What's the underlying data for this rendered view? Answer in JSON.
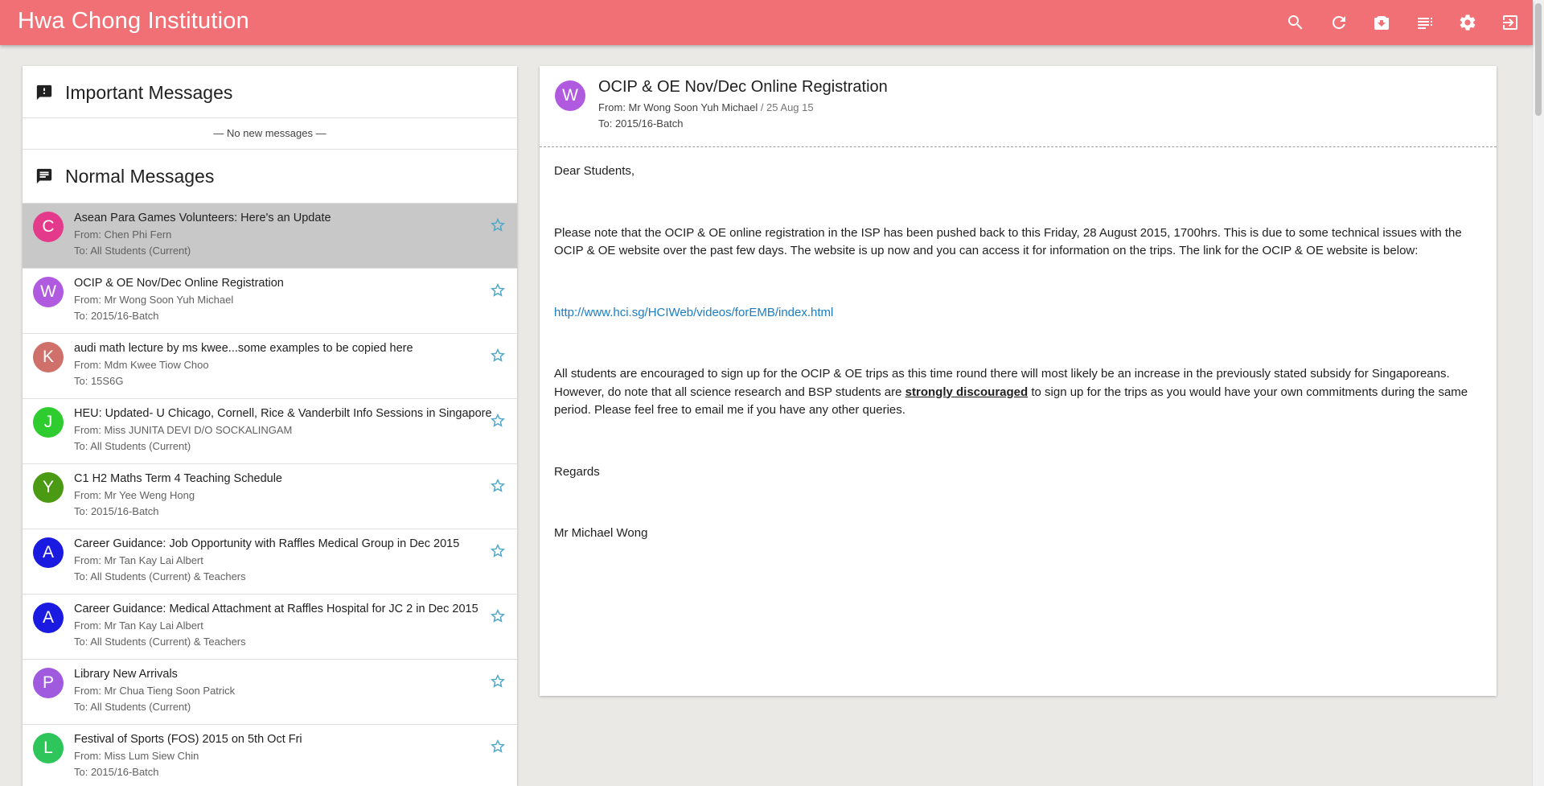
{
  "app": {
    "title": "Hwa Chong Institution"
  },
  "toolbar": {
    "icons": [
      "search-icon",
      "refresh-icon",
      "archive-icon",
      "list-icon",
      "settings-icon",
      "logout-icon"
    ],
    "brand_color": "#f07075"
  },
  "important": {
    "title": "Important Messages",
    "empty_text": "— No new messages —"
  },
  "normal": {
    "title": "Normal Messages",
    "messages": [
      {
        "initial": "C",
        "color": "#e33a8c",
        "subject": "Asean Para Games Volunteers: Here's an Update",
        "from": "From: Chen Phi Fern",
        "to": "To: All Students (Current)",
        "selected": true
      },
      {
        "initial": "W",
        "color": "#b05ae0",
        "subject": "OCIP & OE Nov/Dec Online Registration",
        "from": "From: Mr Wong Soon Yuh Michael",
        "to": "To: 2015/16-Batch"
      },
      {
        "initial": "K",
        "color": "#d0706a",
        "subject": "audi math lecture by ms kwee...some examples to be copied here",
        "from": "From: Mdm Kwee Tiow Choo",
        "to": "To: 15S6G"
      },
      {
        "initial": "J",
        "color": "#2ecc2e",
        "subject": "HEU: Updated- U Chicago, Cornell, Rice & Vanderbilt Info Sessions in Singapore",
        "from": "From: Miss JUNITA DEVI D/O SOCKALINGAM",
        "to": "To: All Students (Current)"
      },
      {
        "initial": "Y",
        "color": "#4a9a14",
        "subject": "C1 H2 Maths Term 4 Teaching Schedule",
        "from": "From: Mr Yee Weng Hong",
        "to": "To: 2015/16-Batch"
      },
      {
        "initial": "A",
        "color": "#1a1ae0",
        "subject": "Career Guidance: Job Opportunity with Raffles Medical Group in Dec 2015",
        "from": "From: Mr Tan Kay Lai Albert",
        "to": "To: All Students (Current) & Teachers"
      },
      {
        "initial": "A",
        "color": "#1a1ae0",
        "subject": "Career Guidance: Medical Attachment at Raffles Hospital for JC 2 in Dec 2015",
        "from": "From: Mr Tan Kay Lai Albert",
        "to": "To: All Students (Current) & Teachers"
      },
      {
        "initial": "P",
        "color": "#a05ae0",
        "subject": "Library New Arrivals",
        "from": "From: Mr Chua Tieng Soon Patrick",
        "to": "To: All Students (Current)"
      },
      {
        "initial": "L",
        "color": "#2ec65a",
        "subject": "Festival of Sports (FOS) 2015 on 5th Oct Fri",
        "from": "From: Miss Lum Siew Chin",
        "to": "To: 2015/16-Batch"
      }
    ]
  },
  "detail": {
    "initial": "W",
    "color": "#b05ae0",
    "subject": "OCIP & OE Nov/Dec Online Registration",
    "from": "From: Mr Wong Soon Yuh Michael",
    "date": " / 25 Aug 15",
    "to": "To: 2015/16-Batch",
    "greeting": "Dear Students,",
    "para1": "Please note that the OCIP & OE online registration in the ISP has been pushed back to this Friday, 28 August 2015, 1700hrs. This is due to some technical issues with the OCIP & OE website over the past few days. The website is up now and you can access it for information on the trips. The link for the OCIP & OE website is below:",
    "link": "http://www.hci.sg/HCIWeb/videos/forEMB/index.html",
    "para2_a": "All students are encouraged to sign up for the OCIP & OE trips as this time round there will most likely be an increase in the previously stated subsidy for Singaporeans. However, do note that all science research and BSP students are ",
    "para2_strong": "strongly discouraged",
    "para2_b": " to sign up for the trips as you would have your own commitments during the same period. Please feel free to email me if you have any other queries.",
    "regards": "Regards",
    "signature": "Mr Michael Wong"
  }
}
